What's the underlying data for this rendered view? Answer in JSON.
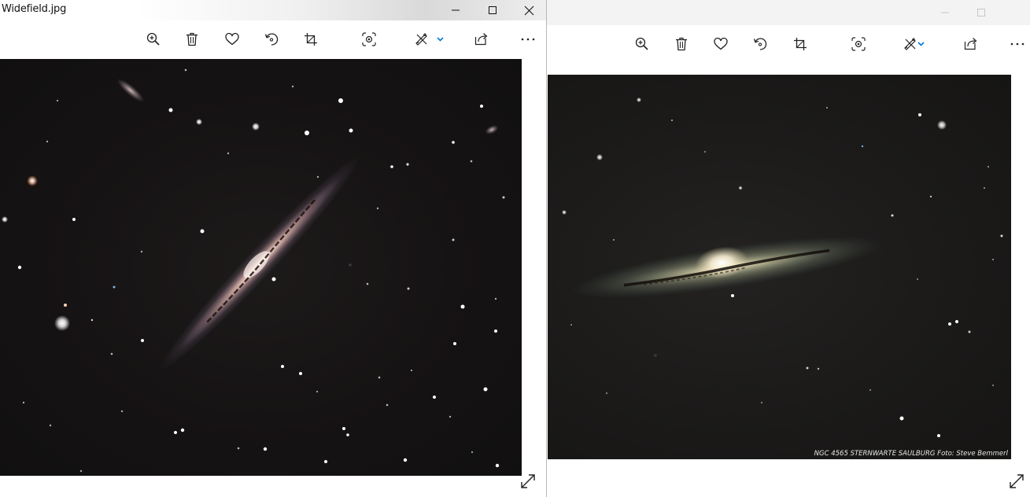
{
  "left_window": {
    "title": "Widefield.jpg",
    "toolbar": [
      {
        "name": "zoom-in-button",
        "icon": "zoom-in-icon"
      },
      {
        "name": "delete-button",
        "icon": "trash-icon"
      },
      {
        "name": "favorite-button",
        "icon": "heart-icon"
      },
      {
        "name": "rotate-button",
        "icon": "rotate-icon"
      },
      {
        "name": "crop-button",
        "icon": "crop-icon"
      },
      {
        "name": "enhance-button",
        "icon": "enhance-icon"
      },
      {
        "name": "edit-create-button",
        "icon": "edit-create-icon"
      },
      {
        "name": "share-button",
        "icon": "share-icon"
      },
      {
        "name": "more-button",
        "icon": "more-icon"
      }
    ],
    "caption_buttons": [
      "minimize-icon",
      "maximize-icon",
      "close-icon"
    ]
  },
  "right_window": {
    "caption": "NGC 4565  STERNWARTE SAULBURG  Foto: Steve Bemmerl",
    "caption_buttons": [
      "minimize-icon",
      "maximize-icon"
    ]
  },
  "colors": {
    "accent": "#0078d4",
    "icon": "#222222",
    "photo_background": "#151213",
    "inactive_caption": "#c6c6c6"
  }
}
